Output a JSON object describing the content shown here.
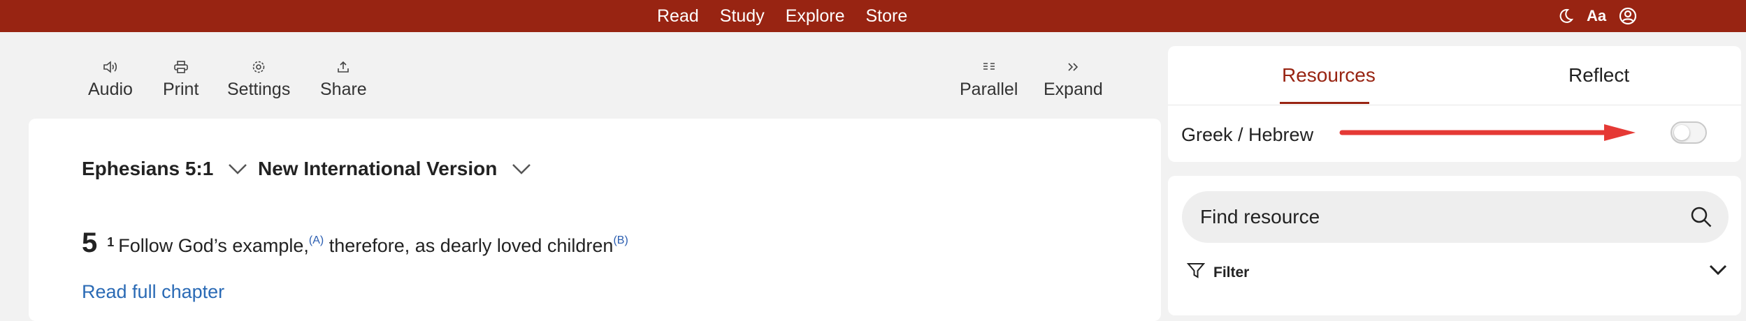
{
  "topnav": {
    "items": [
      "Read",
      "Study",
      "Explore",
      "Store"
    ],
    "icons": [
      "moon-icon",
      "text-size-icon",
      "account-icon"
    ],
    "text_size_label": "Aa"
  },
  "toolbar": {
    "audio": "Audio",
    "print": "Print",
    "settings": "Settings",
    "share": "Share",
    "parallel": "Parallel",
    "expand": "Expand"
  },
  "reader": {
    "reference": "Ephesians 5:1",
    "version": "New International Version",
    "chapter_number": "5",
    "verse_number": "1",
    "verse_text_1": "Follow God’s example,",
    "xref_a": "(A)",
    "verse_text_2": " therefore, as dearly loved children",
    "xref_b": "(B)",
    "read_full": "Read full chapter"
  },
  "panel": {
    "tabs": [
      "Resources",
      "Reflect"
    ],
    "active_tab": "Resources",
    "toggle_label": "Greek / Hebrew",
    "toggle_on": false,
    "search_placeholder": "Find resource",
    "filter_label": "Filter"
  },
  "colors": {
    "brand": "#982412",
    "link": "#2a6ab5",
    "annotation_arrow": "#e53935"
  }
}
